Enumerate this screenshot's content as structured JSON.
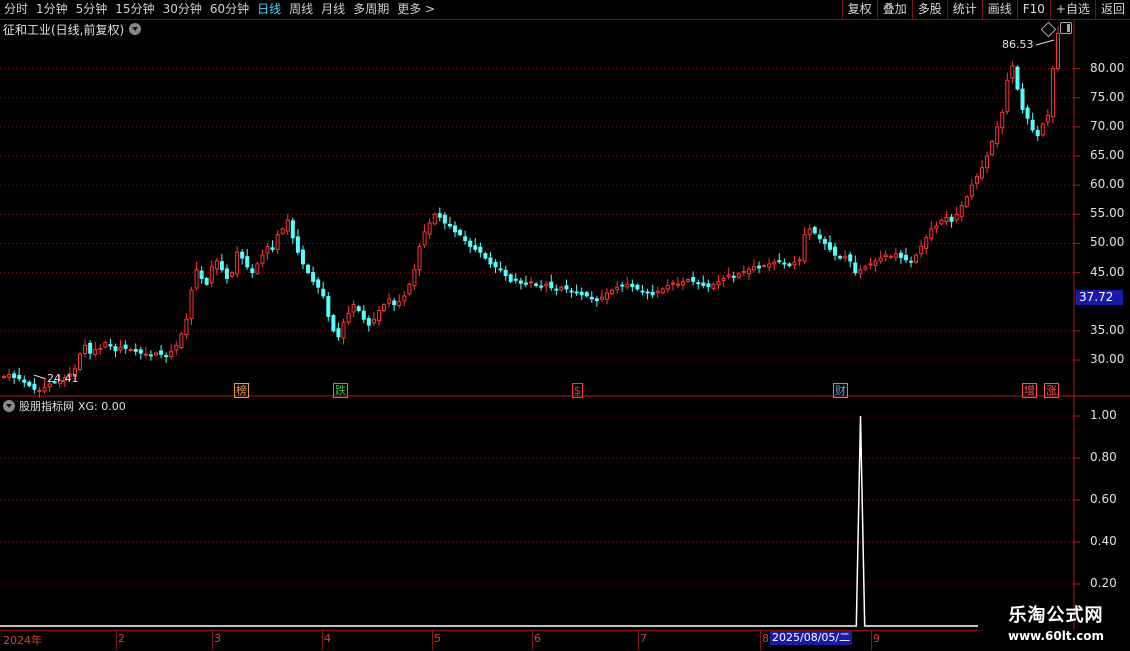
{
  "toolbar": {
    "periods": [
      "分时",
      "1分钟",
      "5分钟",
      "15分钟",
      "30分钟",
      "60分钟",
      "日线",
      "周线",
      "月线",
      "多周期",
      "更多 >"
    ],
    "active_period": "日线",
    "actions": [
      "复权",
      "叠加",
      "多股",
      "统计",
      "画线",
      "F10",
      "+自选",
      "返回"
    ]
  },
  "main_chart": {
    "title": "征和工业(日线,前复权)",
    "price_axis": [
      "80.00",
      "75.00",
      "70.00",
      "65.00",
      "60.00",
      "55.00",
      "50.00",
      "45.00",
      "35.00",
      "30.00"
    ],
    "current_price": "37.72",
    "high_label": "86.53",
    "low_label": "24.41",
    "markers": [
      {
        "text": "榜",
        "color": "#e8a040"
      },
      {
        "text": "跌",
        "color": "#40c040"
      },
      {
        "text": "$",
        "color": "#ff3030"
      },
      {
        "text": "财",
        "color": "#4aa8ff"
      },
      {
        "text": "增",
        "color": "#ff5050"
      },
      {
        "text": "涨",
        "color": "#ff5050"
      }
    ],
    "colors": {
      "up": "#ff3232",
      "down": "#54ffff",
      "grid": "#7a1010",
      "axis": "#b01818"
    }
  },
  "indicator": {
    "title": "股朋指标网",
    "value_label": "XG: 0.00",
    "axis": [
      "1.00",
      "0.80",
      "0.60",
      "0.40",
      "0.20"
    ],
    "xg_values_note_free": true,
    "xg": [
      0,
      0,
      0,
      0,
      0,
      0,
      0,
      0,
      0,
      0,
      0,
      0,
      0,
      0,
      0,
      0,
      0,
      0,
      0,
      0,
      0,
      0,
      0,
      0,
      0,
      0,
      0,
      0,
      0,
      0,
      0,
      0,
      0,
      0,
      0,
      0,
      0,
      0,
      0,
      0,
      0,
      0,
      0,
      0,
      0,
      0,
      0,
      0,
      0,
      0,
      0,
      0,
      0,
      0,
      0,
      0,
      0,
      0,
      0,
      0,
      0,
      0,
      0,
      0,
      0,
      0,
      0,
      0,
      0,
      0,
      0,
      0,
      0,
      0,
      0,
      0,
      0,
      0,
      0,
      0,
      0,
      0,
      0,
      0,
      0,
      0,
      0,
      0,
      0,
      0,
      0,
      0,
      0,
      0,
      0,
      0,
      0,
      0,
      0,
      0,
      0,
      0,
      0,
      0,
      0,
      0,
      0,
      0,
      0,
      0,
      0,
      0,
      0,
      0,
      0,
      0,
      0,
      0,
      0,
      0,
      0,
      0,
      0,
      0,
      0,
      0,
      0,
      0,
      0,
      0,
      0,
      0,
      0,
      0,
      0,
      0,
      0,
      0,
      0,
      0,
      0,
      0,
      0,
      0,
      0,
      0,
      0,
      0,
      0,
      0,
      0,
      0,
      0,
      0,
      0,
      0,
      0,
      0,
      0,
      0,
      0,
      0,
      0,
      0,
      0,
      0,
      0,
      0,
      0,
      0,
      0,
      0,
      0,
      0,
      0,
      0,
      0,
      0,
      0,
      0,
      0,
      0,
      0,
      0,
      0,
      0,
      0,
      0,
      0,
      0,
      0,
      0,
      0,
      0,
      0,
      0,
      0,
      0,
      0,
      0,
      0,
      0,
      0,
      0,
      0,
      1,
      0,
      0,
      0,
      0,
      0,
      0,
      0,
      0,
      0,
      0,
      0,
      0,
      0,
      0,
      0,
      0,
      0,
      0,
      0,
      0,
      0,
      0,
      0,
      0,
      0,
      0,
      0,
      0
    ]
  },
  "date_axis": {
    "months": [
      "2024年",
      "2",
      "3",
      "4",
      "5",
      "6",
      "7",
      "8",
      "9"
    ],
    "cursor": "2025/08/05/二"
  },
  "watermark": {
    "title": "乐淘公式网",
    "url": "www.60lt.com"
  },
  "chart_data": {
    "type": "candlestick",
    "title": "征和工业(日线,前复权)",
    "ylim": [
      24,
      88
    ],
    "closes": [
      27.2,
      27.5,
      27.0,
      26.8,
      26.2,
      25.6,
      25.0,
      24.8,
      25.3,
      25.9,
      26.2,
      26.5,
      27.0,
      27.6,
      28.5,
      31.0,
      32.5,
      31.2,
      31.8,
      32.0,
      33.0,
      32.4,
      31.6,
      32.2,
      32.0,
      31.8,
      31.5,
      31.2,
      31.0,
      30.8,
      31.2,
      31.0,
      30.6,
      31.5,
      32.5,
      34.5,
      37.0,
      42.0,
      45.5,
      44.0,
      43.0,
      46.0,
      47.0,
      45.5,
      44.0,
      45.0,
      48.5,
      47.5,
      46.0,
      45.0,
      46.5,
      48.0,
      49.5,
      49.0,
      51.5,
      52.5,
      54.0,
      51.0,
      48.5,
      46.5,
      45.0,
      43.5,
      42.5,
      41.0,
      37.5,
      35.0,
      34.0,
      36.5,
      38.0,
      39.5,
      38.5,
      37.0,
      36.0,
      37.0,
      38.5,
      39.5,
      40.5,
      39.5,
      40.0,
      41.0,
      43.0,
      45.5,
      49.5,
      52.0,
      53.5,
      55.0,
      54.5,
      53.5,
      53.0,
      52.0,
      51.5,
      50.5,
      49.5,
      49.0,
      48.5,
      47.5,
      46.5,
      46.0,
      45.5,
      44.5,
      43.5,
      43.8,
      43.2,
      43.0,
      43.4,
      42.8,
      42.6,
      43.0,
      42.4,
      42.0,
      42.5,
      42.2,
      41.8,
      41.5,
      41.2,
      41.0,
      40.5,
      40.2,
      40.8,
      41.5,
      42.0,
      42.5,
      42.8,
      43.0,
      42.6,
      42.2,
      41.8,
      41.5,
      41.2,
      41.8,
      42.2,
      42.8,
      43.2,
      43.0,
      43.4,
      43.8,
      43.5,
      43.2,
      42.8,
      42.6,
      43.0,
      43.5,
      44.0,
      44.6,
      44.2,
      44.8,
      45.2,
      45.6,
      46.0,
      45.8,
      46.2,
      46.5,
      46.8,
      47.0,
      46.6,
      46.2,
      46.8,
      47.2,
      51.5,
      52.5,
      51.8,
      50.8,
      50.0,
      49.0,
      48.0,
      47.5,
      47.8,
      47.0,
      45.0,
      45.5,
      46.0,
      46.5,
      47.0,
      47.5,
      48.0,
      47.8,
      48.2,
      47.6,
      47.2,
      46.8,
      48.0,
      49.5,
      51.0,
      52.5,
      53.0,
      54.0,
      54.5,
      53.8,
      55.0,
      56.5,
      58.0,
      60.0,
      61.5,
      63.0,
      65.0,
      67.5,
      70.0,
      72.5,
      78.0,
      80.5,
      76.5,
      73.0,
      71.5,
      69.5,
      68.5,
      70.5,
      72.0,
      80.0,
      86.0
    ],
    "markers": [
      "榜",
      "跌",
      "$",
      "财",
      "增",
      "涨"
    ]
  }
}
